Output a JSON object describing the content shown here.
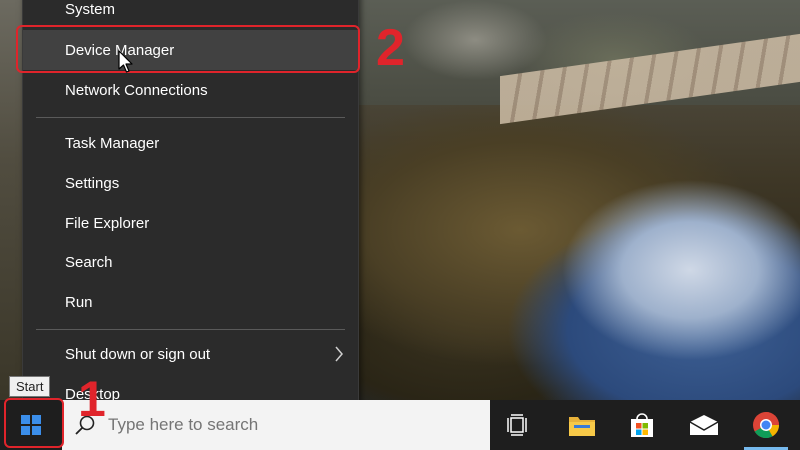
{
  "menu": {
    "items": [
      {
        "label": "System",
        "has_submenu": false
      },
      {
        "label": "Device Manager",
        "has_submenu": false,
        "hovered": true
      },
      {
        "label": "Network Connections",
        "has_submenu": false
      },
      {
        "label": "Task Manager",
        "has_submenu": false
      },
      {
        "label": "Settings",
        "has_submenu": false
      },
      {
        "label": "File Explorer",
        "has_submenu": false
      },
      {
        "label": "Search",
        "has_submenu": false
      },
      {
        "label": "Run",
        "has_submenu": false
      },
      {
        "label": "Shut down or sign out",
        "has_submenu": true
      },
      {
        "label": "Desktop",
        "has_submenu": false
      }
    ]
  },
  "annotations": {
    "step_1": "1",
    "step_2": "2",
    "highlight_color": "#e0242b"
  },
  "taskbar": {
    "start_tooltip": "Start",
    "search_placeholder": "Type here to search",
    "icons": [
      "start-icon",
      "task-view-icon",
      "file-explorer-icon",
      "store-icon",
      "mail-icon",
      "chrome-icon"
    ]
  }
}
